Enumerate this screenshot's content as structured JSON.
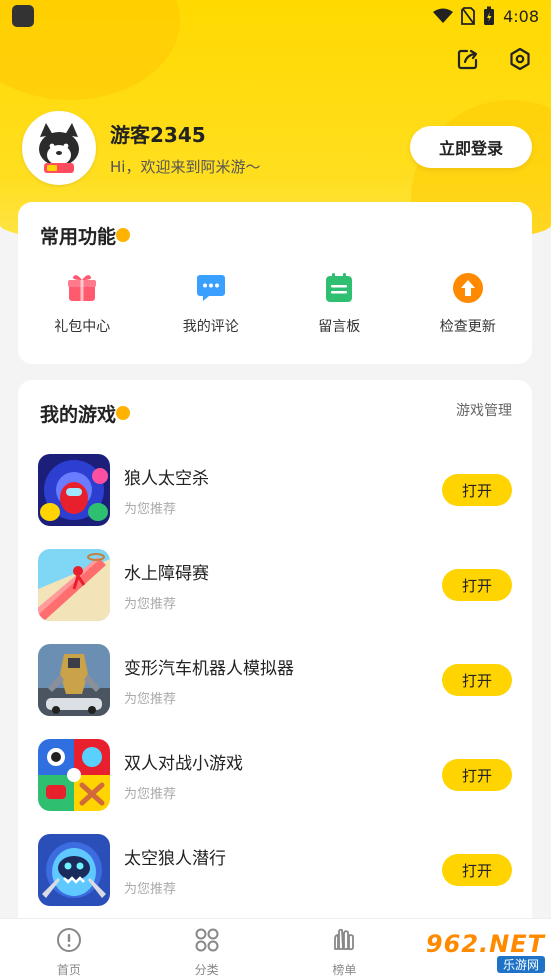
{
  "status_bar": {
    "time": "4:08"
  },
  "profile": {
    "username": "游客2345",
    "greeting": "Hi，欢迎来到阿米游～",
    "login_label": "立即登录"
  },
  "functions": {
    "title": "常用功能",
    "items": [
      {
        "label": "礼包中心",
        "icon": "gift-icon",
        "color": "#ff5a6e"
      },
      {
        "label": "我的评论",
        "icon": "comment-icon",
        "color": "#3aa0ff"
      },
      {
        "label": "留言板",
        "icon": "message-board-icon",
        "color": "#2fbf71"
      },
      {
        "label": "检查更新",
        "icon": "update-icon",
        "color": "#ff8a00"
      }
    ]
  },
  "my_games": {
    "title": "我的游戏",
    "manage_label": "游戏管理",
    "items": [
      {
        "name": "狼人太空杀",
        "subtitle": "为您推荐",
        "button": "打开"
      },
      {
        "name": "水上障碍赛",
        "subtitle": "为您推荐",
        "button": "打开"
      },
      {
        "name": "变形汽车机器人模拟器",
        "subtitle": "为您推荐",
        "button": "打开"
      },
      {
        "name": "双人对战小游戏",
        "subtitle": "为您推荐",
        "button": "打开"
      },
      {
        "name": "太空狼人潜行",
        "subtitle": "为您推荐",
        "button": "打开"
      }
    ]
  },
  "tabbar": {
    "items": [
      {
        "label": "首页",
        "icon": "home-icon"
      },
      {
        "label": "分类",
        "icon": "category-icon"
      },
      {
        "label": "榜单",
        "icon": "ranking-icon"
      }
    ]
  },
  "watermark": {
    "big": "962.NET",
    "small": "乐游网"
  },
  "colors": {
    "accent": "#ffd400",
    "hero": "#ffd900"
  }
}
